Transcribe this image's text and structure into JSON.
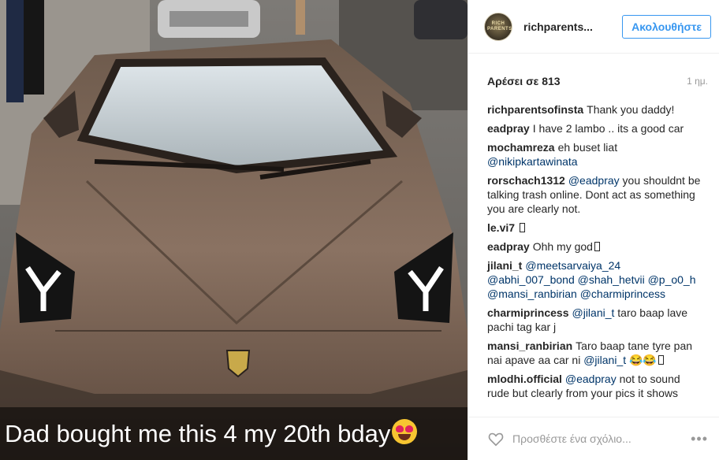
{
  "photo": {
    "caption": "Dad bought me this 4 my 20th bday"
  },
  "header": {
    "avatar_text": "RICH PARENTS",
    "username": "richparents...",
    "follow_label": "Ακολουθήστε"
  },
  "stats": {
    "likes": "Αρέσει σε 813",
    "time": "1 ημ."
  },
  "comments": [
    {
      "user": "richparentsofinsta",
      "text": "Thank you daddy!"
    },
    {
      "user": "eadpray",
      "text": "I have 2 lambo .. its a good car"
    },
    {
      "user": "mochamreza",
      "text": "eh buset liat",
      "mention": "@nikipkartawinata"
    },
    {
      "user": "rorschach1312",
      "mention": "@eadpray",
      "text": "you shouldnt be talking trash online. Dont act as something you are clearly not."
    },
    {
      "user": "le.vi7",
      "text": ""
    },
    {
      "user": "eadpray",
      "text": "Ohh my god"
    },
    {
      "user": "jilani_t",
      "mentions": "@meetsarvaiya_24 @abhi_007_bond @shah_hetvii @p_o0_h @mansi_ranbirian @charmiprincess"
    },
    {
      "user": "charmiprincess",
      "mention": "@jilani_t",
      "text": "taro baap lave pachi tag kar j"
    },
    {
      "user": "mansi_ranbirian",
      "text": "Taro baap tane tyre pan nai apave aa car ni",
      "mention": "@jilani_t",
      "tail": "😂😂"
    },
    {
      "user": "mlodhi.official",
      "mention": "@eadpray",
      "text": "not to sound rude but clearly from your pics it shows"
    }
  ],
  "footer": {
    "placeholder": "Προσθέστε ένα σχόλιο...",
    "more": "•••"
  },
  "colors": {
    "accent": "#3897f0",
    "mention": "#003569",
    "muted": "#999999"
  }
}
